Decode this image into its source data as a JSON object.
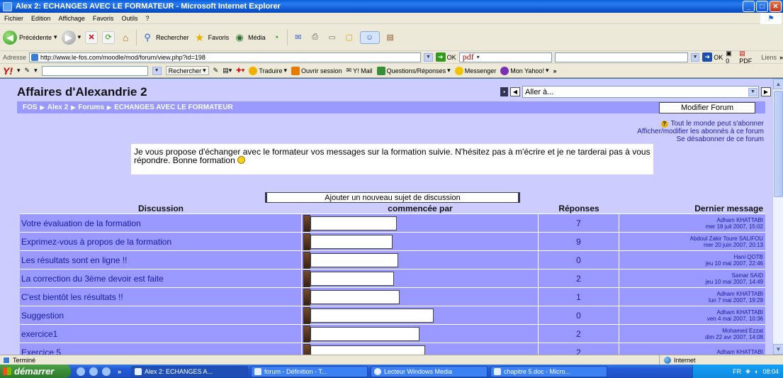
{
  "window": {
    "title": "Alex 2: ECHANGES AVEC LE FORMATEUR - Microsoft Internet Explorer"
  },
  "menu": [
    "Fichier",
    "Edition",
    "Affichage",
    "Favoris",
    "Outils",
    "?"
  ],
  "toolbar": {
    "back_label": "Précédente",
    "search_label": "Rechercher",
    "favorites_label": "Favoris",
    "media_label": "Média"
  },
  "address": {
    "label": "Adresse",
    "url": "http://www.le-fos.com/moodle/mod/forum/view.php?id=198",
    "go_label": "OK",
    "pdf_label": "pdf",
    "go2_label": "OK",
    "count": "0",
    "pdf2_label": "PDF",
    "links_label": "Liens"
  },
  "yahoo": {
    "search_label": "Rechercher",
    "translate_label": "Traduire",
    "session_label": "Ouvrir session",
    "mail_label": "Y! Mail",
    "qa_label": "Questions/Réponses",
    "messenger_label": "Messenger",
    "myyahoo_label": "Mon Yahoo!"
  },
  "page": {
    "site_title": "Affaires d'Alexandrie 2",
    "goto_label": "Aller à...",
    "breadcrumb": [
      "FOS",
      "Alex 2",
      "Forums",
      "ECHANGES AVEC LE FORMATEUR"
    ],
    "modify_button": "Modifier Forum",
    "subscribe_all": "Tout le monde peut s'abonner",
    "subscribers_link": "Afficher/modifier les abonnés à ce forum",
    "unsubscribe_link": "Se désabonner de ce forum",
    "intro": "Je vous propose d'échanger avec le formateur vos messages sur la formation suivie. N'hésitez pas à m'écrire et je ne tarderai pas à vous répondre. Bonne formation",
    "add_topic_button": "Ajouter un nouveau sujet de discussion"
  },
  "table": {
    "headers": [
      "Discussion",
      "commencée par",
      "Réponses",
      "Dernier message"
    ],
    "rows": [
      {
        "discussion": "Votre évaluation de la formation",
        "replies": "7",
        "last_author": "Adham KHATTABI",
        "last_date": "mer 18 juil 2007, 15:02"
      },
      {
        "discussion": "Exprimez-vous à propos de la formation",
        "replies": "9",
        "last_author": "Abdoul Zakir Toure SALIFOU",
        "last_date": "mer 20 juin 2007, 20:13"
      },
      {
        "discussion": "Les résultats sont en ligne !!",
        "replies": "0",
        "last_author": "Hani QOTB",
        "last_date": "jeu 10 mai 2007, 22:46"
      },
      {
        "discussion": "La correction du 3ème devoir est faite",
        "replies": "2",
        "last_author": "Samar SAID",
        "last_date": "jeu 10 mai 2007, 14:49"
      },
      {
        "discussion": "C'est bientôt les résultats !!",
        "replies": "1",
        "last_author": "Adham KHATTABI",
        "last_date": "lun 7 mai 2007, 19:29"
      },
      {
        "discussion": "Suggestion",
        "replies": "0",
        "last_author": "Adham KHATTABI",
        "last_date": "ven 4 mai 2007, 10:36"
      },
      {
        "discussion": "exercice1",
        "replies": "2",
        "last_author": "Mohamed Ezzat",
        "last_date": "dim 22 avr 2007, 14:08"
      },
      {
        "discussion": "Exercice 5",
        "replies": "2",
        "last_author": "Adham KHATTABI",
        "last_date": ""
      }
    ]
  },
  "status": {
    "text": "Terminé",
    "zone": "Internet"
  },
  "taskbar": {
    "start_label": "démarrer",
    "tasks": [
      "Alex 2: ECHANGES A...",
      "forum - Définition - T...",
      "Lecteur Windows Media",
      "chapitre 5.doc - Micro..."
    ],
    "lang": "FR",
    "clock": "08:04"
  }
}
